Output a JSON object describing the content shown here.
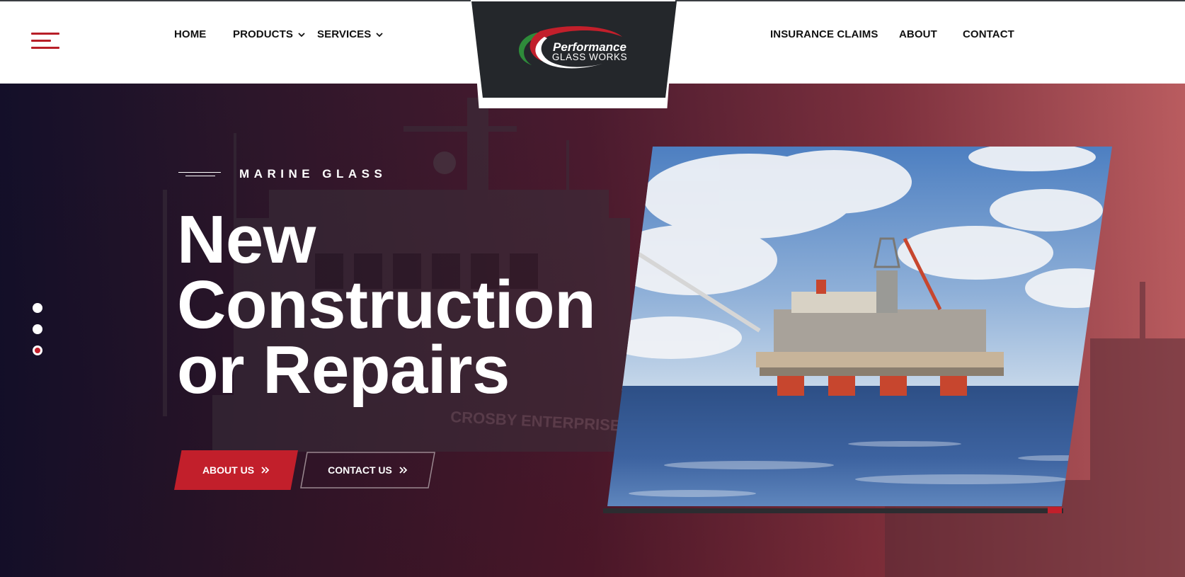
{
  "header": {
    "logo": {
      "line1": "Performance",
      "line2": "GLASS WORKS"
    },
    "menu_icon": "hamburger-menu-icon",
    "nav_left": [
      {
        "label": "HOME",
        "has_dropdown": false
      },
      {
        "label": "PRODUCTS",
        "has_dropdown": true
      },
      {
        "label": "SERVICES",
        "has_dropdown": true
      }
    ],
    "nav_right": [
      {
        "label": "INSURANCE CLAIMS"
      },
      {
        "label": "ABOUT"
      },
      {
        "label": "CONTACT"
      }
    ]
  },
  "hero": {
    "eyebrow": "MARINE GLASS",
    "headline_lines": [
      "New",
      "Construction",
      "or Repairs"
    ],
    "buttons": {
      "primary": {
        "label": "ABOUT US",
        "icon": "double-chevron-right-icon"
      },
      "secondary": {
        "label": "CONTACT US",
        "icon": "double-chevron-right-icon"
      }
    },
    "slider": {
      "count": 3,
      "active_index": 2
    },
    "background_text": "CROSBY ENTERPRISE"
  },
  "colors": {
    "accent_red": "#c21f2b",
    "dark_plate": "#24272b",
    "logo_green": "#2e8b3a",
    "nav_text": "#111111"
  }
}
